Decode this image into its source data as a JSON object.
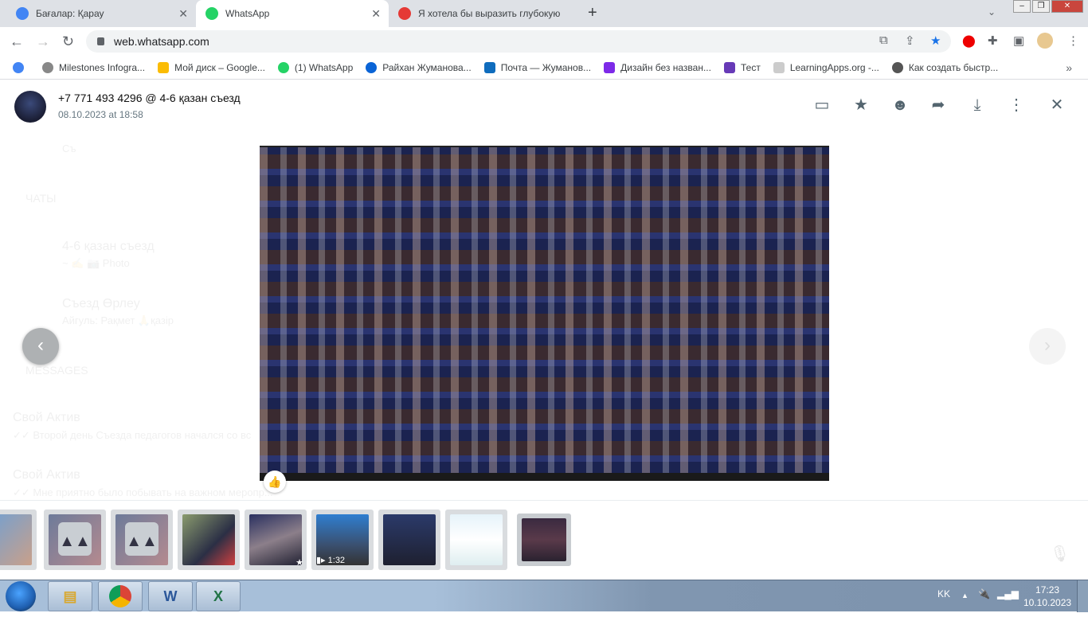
{
  "browser": {
    "tabs": [
      {
        "title": "Бағалар: Қарау",
        "active": false,
        "color": "#4285f4"
      },
      {
        "title": "WhatsApp",
        "active": true,
        "color": "#25d366"
      },
      {
        "title": "Я хотела бы выразить глубокую",
        "active": false,
        "color": "#e53935"
      }
    ],
    "new_tab": "+",
    "url": "web.whatsapp.com",
    "bookmarks": [
      {
        "label": "",
        "color": "#4285f4"
      },
      {
        "label": "Milestones Infogra...",
        "color": "#666"
      },
      {
        "label": "Мой диск – Google...",
        "color": "#fbbc04"
      },
      {
        "label": "(1) WhatsApp",
        "color": "#25d366"
      },
      {
        "label": "Райхан Жуманова...",
        "color": "#0a64d6"
      },
      {
        "label": "Почта — Жуманов...",
        "color": "#0f6cbd"
      },
      {
        "label": "Дизайн без назван...",
        "color": "#7d2ae8"
      },
      {
        "label": "Тест",
        "color": "#673ab7"
      },
      {
        "label": "LearningApps.org -...",
        "color": "#bbb"
      },
      {
        "label": "Как создать быстр...",
        "color": "#555"
      }
    ],
    "bookmarks_more": "»"
  },
  "viewer": {
    "title": "+7 771 493 4296 @ 4-6 қазан съезд",
    "subtitle": "08.10.2023 at 18:58",
    "actions": [
      "reply-icon",
      "star-icon",
      "emoji-icon",
      "forward-icon",
      "download-icon",
      "menu-icon",
      "close-icon"
    ],
    "reaction": "👍",
    "background": {
      "search": "Съ",
      "chats_header": "ЧАТЫ",
      "chat1_name": "4-6 қазан съезд",
      "chat1_preview": "~ ✍ 📷 Photo",
      "chat2_name": "Съезд Өрлеу",
      "chat2_preview": "Айгуль: Рақмет 🙏қазір",
      "messages_header": "MESSAGES",
      "msg1_name": "Свой Актив",
      "msg1_text": "✓✓ Второй день Съезда педагогов начался со вс",
      "msg2_name": "Свой Актив",
      "msg2_text": "✓✓ Мне приятно было побывать на важном меропр..."
    },
    "thumbnails": [
      {
        "type": "image"
      },
      {
        "type": "placeholder"
      },
      {
        "type": "placeholder"
      },
      {
        "type": "image"
      },
      {
        "type": "image",
        "starred": true,
        "star": "★"
      },
      {
        "type": "video",
        "duration": "1:32"
      },
      {
        "type": "image"
      },
      {
        "type": "image"
      },
      {
        "type": "image",
        "selected": true
      }
    ]
  },
  "taskbar": {
    "apps": [
      "explorer",
      "chrome",
      "word",
      "excel"
    ],
    "lang": "KK",
    "time": "17:23",
    "date": "10.10.2023"
  }
}
